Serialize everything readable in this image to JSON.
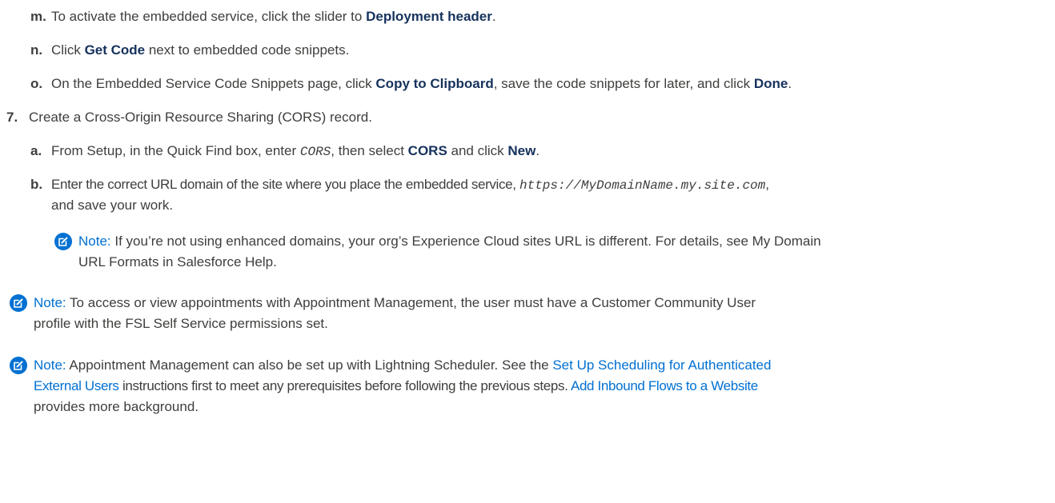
{
  "steps": {
    "m": {
      "label": "m.",
      "p1": "To activate the embedded service, click the slider to ",
      "b1": "Deployment header",
      "p2": "."
    },
    "n": {
      "label": "n.",
      "p1": "Click ",
      "b1": "Get Code",
      "p2": " next to embedded code snippets."
    },
    "o": {
      "label": "o.",
      "p1": "On the Embedded Service Code Snippets page, click ",
      "b1": "Copy to Clipboard",
      "p2": ", save the code snippets for later, and click ",
      "b2": "Done",
      "p3": "."
    },
    "s7": {
      "label": "7.",
      "text": "Create a Cross-Origin Resource Sharing (CORS) record."
    },
    "a": {
      "label": "a.",
      "p1": "From Setup, in the Quick Find box, enter ",
      "code": "CORS",
      "p2": ", then select ",
      "b1": "CORS",
      "p3": " and click ",
      "b2": "New",
      "p4": "."
    },
    "b": {
      "label": "b.",
      "p1": "Enter the correct URL domain of the site where you place the embedded service, ",
      "code": "https://MyDomainName.my.site.com",
      "p2": ",",
      "line2": "and save your work."
    }
  },
  "note1": {
    "title": "Note:",
    "line1": " If you’re not using enhanced domains, your org’s Experience Cloud sites URL is different. For details, see My Domain",
    "line2": "URL Formats in Salesforce Help."
  },
  "note2": {
    "title": "Note:",
    "line1": "  To access or view appointments with Appointment Management, the user must have a Customer Community User",
    "line2": "profile with the FSL Self Service permissions set."
  },
  "note3": {
    "title": "Note:",
    "l1_text": "  Appointment Management can also be set up with Lightning Scheduler. See the ",
    "l1_link": "Set Up Scheduling for Authenticated",
    "l2_link": "External Users",
    "l2_text": " instructions first to meet any prerequisites before following the previous steps. ",
    "l2_link2": "Add Inbound Flows to a Website",
    "l3_text": "provides more background."
  },
  "colors": {
    "accent": "#0070d2",
    "text": "#3e3e3c"
  },
  "icons": {
    "note": "note-edit-icon"
  }
}
